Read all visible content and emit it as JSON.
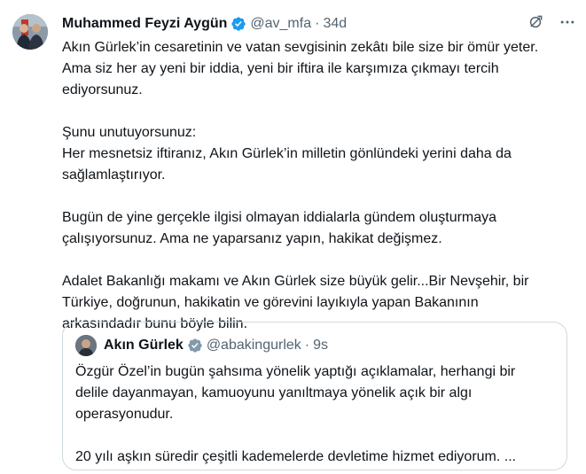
{
  "tweet": {
    "author_name": "Muhammed Feyzi Aygün",
    "handle": "@av_mfa",
    "separator": "·",
    "time": "34d",
    "paragraphs": [
      [
        "Akın Gürlek’in cesaretinin ve vatan sevgisinin zekâtı bile size bir ömür yeter.",
        "Ama siz her ay yeni bir iddia, yeni bir iftira ile karşımıza çıkmayı tercih",
        "ediyorsunuz."
      ],
      [
        "Şunu unutuyorsunuz:",
        "Her mesnetsiz iftiranız, Akın Gürlek’in milletin gönlündeki yerini daha da",
        "sağlamlaştırıyor."
      ],
      [
        "Bugün de yine gerçekle ilgisi olmayan iddialarla gündem oluşturmaya",
        "çalışıyorsunuz. Ama ne yaparsanız yapın, hakikat değişmez."
      ],
      [
        "Adalet Bakanlığı makamı ve Akın Gürlek size büyük gelir...Bir Nevşehir, bir",
        "Türkiye, doğrunun, hakikatin ve görevini layıkıyla yapan Bakanının",
        "arkasındadır bunu böyle bilin."
      ]
    ]
  },
  "quote": {
    "author_name": "Akın Gürlek",
    "handle": "@abakingurlek",
    "separator": "·",
    "time": "9s",
    "paragraphs": [
      [
        "Özgür Özel’in bugün şahsıma yönelik yaptığı açıklamalar, herhangi bir",
        "delile dayanmayan, kamuoyunu yanıltmaya yönelik açık bir algı",
        "operasyonudur."
      ],
      [
        "20 yılı aşkın süredir çeşitli kademelerde devletime hizmet ediyorum. ..."
      ]
    ]
  },
  "icons": {
    "verified": "verified-badge-icon",
    "grok": "grok-icon",
    "more": "more-options-icon"
  },
  "colors": {
    "verified": "#1d9bf0",
    "secondary_text": "#536471",
    "border": "#cfd9de"
  }
}
